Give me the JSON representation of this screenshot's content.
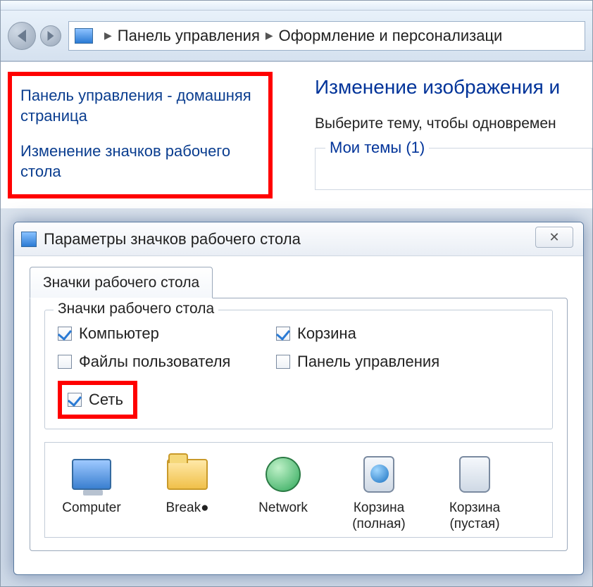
{
  "breadcrumb": {
    "items": [
      "Панель управления",
      "Оформление и персонализаци"
    ]
  },
  "sidebar": {
    "home_link": "Панель управления - домашняя страница",
    "change_icons_link": "Изменение значков рабочего стола"
  },
  "page": {
    "heading": "Изменение изображения и",
    "subtitle": "Выберите тему, чтобы одновремен",
    "themes_legend": "Мои темы (1)"
  },
  "dialog": {
    "title": "Параметры значков рабочего стола",
    "close_glyph": "✕",
    "tab_label": "Значки рабочего стола",
    "group_legend": "Значки рабочего стола",
    "checks": {
      "computer": {
        "label": "Компьютер",
        "checked": true
      },
      "recycle_bin": {
        "label": "Корзина",
        "checked": true
      },
      "user_files": {
        "label": "Файлы пользователя",
        "checked": false
      },
      "control_panel": {
        "label": "Панель управления",
        "checked": false
      },
      "network": {
        "label": "Сеть",
        "checked": true
      }
    },
    "icons": [
      {
        "name": "computer-icon",
        "label": "Computer"
      },
      {
        "name": "user-icon",
        "label": "Break●"
      },
      {
        "name": "network-icon",
        "label": "Network"
      },
      {
        "name": "recycle-full-icon",
        "label": "Корзина (полная)"
      },
      {
        "name": "recycle-empty-icon",
        "label": "Корзина (пустая)"
      }
    ]
  }
}
